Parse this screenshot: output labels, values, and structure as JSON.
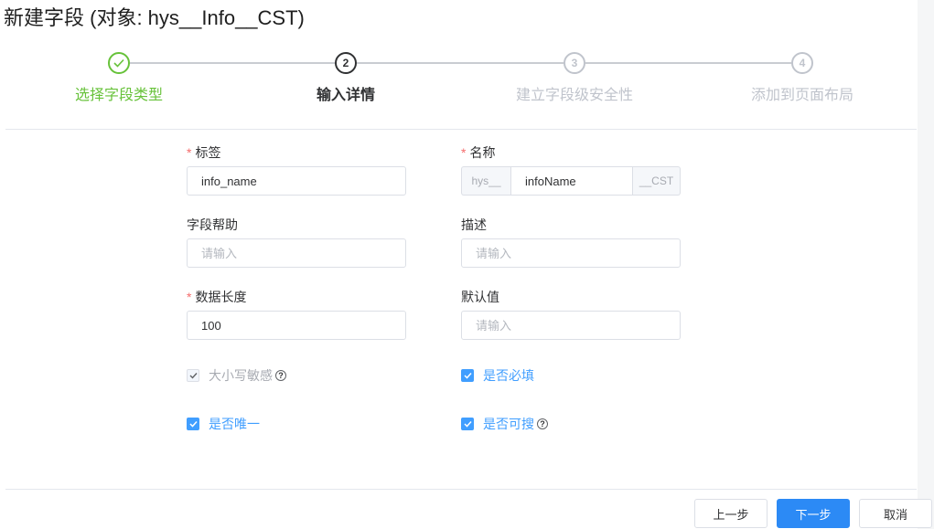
{
  "title": "新建字段 (对象: hys__Info__CST)",
  "steps": [
    {
      "number": "1",
      "label": "选择字段类型",
      "status": "done"
    },
    {
      "number": "2",
      "label": "输入详情",
      "status": "active"
    },
    {
      "number": "3",
      "label": "建立字段级安全性",
      "status": "pending"
    },
    {
      "number": "4",
      "label": "添加到页面布局",
      "status": "pending"
    }
  ],
  "form": {
    "label": {
      "label": "标签",
      "value": "info_name"
    },
    "name": {
      "label": "名称",
      "prefix": "hys__",
      "value": "infoName",
      "suffix": "__CST"
    },
    "help": {
      "label": "字段帮助",
      "placeholder": "请输入"
    },
    "description": {
      "label": "描述",
      "placeholder": "请输入"
    },
    "length": {
      "label": "数据长度",
      "value": "100"
    },
    "default": {
      "label": "默认值",
      "placeholder": "请输入"
    },
    "required_mark": "*",
    "checks": {
      "case_sensitive": {
        "label": "大小写敏感",
        "checked": true,
        "disabled": true
      },
      "required": {
        "label": "是否必填",
        "checked": true
      },
      "unique": {
        "label": "是否唯一",
        "checked": true
      },
      "searchable": {
        "label": "是否可搜",
        "checked": true
      }
    }
  },
  "footer": {
    "prev": "上一步",
    "next": "下一步",
    "cancel": "取消"
  },
  "colors": {
    "accent": "#409eff",
    "success": "#67c23a",
    "primary_button": "#2c8af5",
    "required": "#f56c6c"
  },
  "icons": {
    "check": "check-icon",
    "help": "question-circle-icon"
  }
}
